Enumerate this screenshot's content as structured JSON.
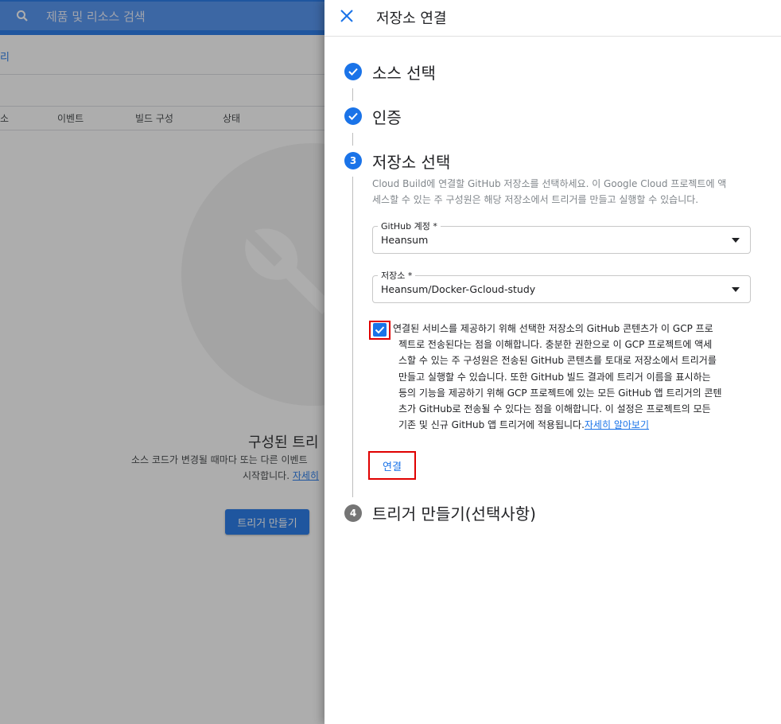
{
  "background": {
    "search_placeholder": "제품 및 리소스 검색",
    "breadcrumb_fragment": "리",
    "table_headers": [
      "소",
      "이벤트",
      "빌드 구성",
      "상태"
    ],
    "empty_title": "구성된 트리",
    "empty_desc_line1": "소스 코드가 변경될 때마다 또는 다른 이벤트",
    "empty_desc_line2": "시작합니다.",
    "empty_desc_link": "자세히",
    "create_trigger_button": "트리거 만들기"
  },
  "panel": {
    "title": "저장소 연결",
    "steps": [
      {
        "number": "1",
        "title": "소스 선택",
        "state": "done"
      },
      {
        "number": "2",
        "title": "인증",
        "state": "done"
      },
      {
        "number": "3",
        "title": "저장소 선택",
        "state": "active"
      },
      {
        "number": "4",
        "title": "트리거 만들기(선택사항)",
        "state": "inactive"
      }
    ],
    "step3": {
      "description_line1": "Cloud Build에 연결할 GitHub 저장소를 선택하세요. 이 Google Cloud 프로젝트에 액",
      "description_line2": "세스할 수 있는 주 구성원은 해당 저장소에서 트리거를 만들고 실행할 수 있습니다.",
      "github_account": {
        "label": "GitHub 계정 *",
        "value": "Heansum"
      },
      "repository": {
        "label": "저장소 *",
        "value": "Heansum/Docker-Gcloud-study"
      },
      "consent": {
        "checked": true,
        "lines": [
          "연결된 서비스를 제공하기 위해 선택한 저장소의 GitHub 콘텐츠가 이 GCP 프로",
          "젝트로 전송된다는 점을 이해합니다. 충분한 권한으로 이 GCP 프로젝트에 액세",
          "스할 수 있는 주 구성원은 전송된 GitHub 콘텐츠를 토대로 저장소에서 트리거를",
          "만들고 실행할 수 있습니다. 또한 GitHub 빌드 결과에 트리거 이름을 표시하는",
          "등의 기능을 제공하기 위해 GCP 프로젝트에 있는 모든 GitHub 앱 트리거의 콘텐",
          "츠가 GitHub로 전송될 수 있다는 점을 이해합니다. 이 설정은 프로젝트의 모든",
          "기존 및 신규 GitHub 앱 트리거에 적용됩니다."
        ],
        "link": "자세히 알아보기"
      },
      "connect_button": "연결"
    }
  },
  "colors": {
    "accent": "#1a73e8",
    "highlight": "#e00000",
    "inactive_step": "#757575"
  }
}
